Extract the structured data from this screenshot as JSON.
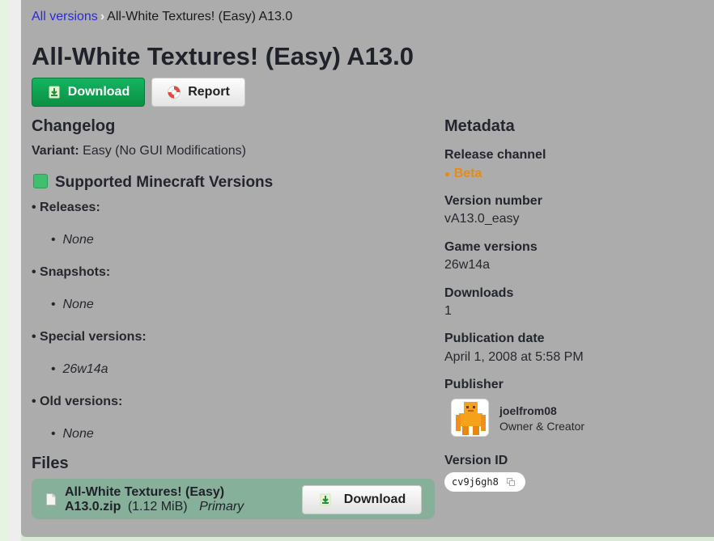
{
  "breadcrumb": {
    "parent": "All versions",
    "current": "All-White Textures! (Easy) A13.0"
  },
  "title": "All-White Textures! (Easy) A13.0",
  "actions": {
    "download": "Download",
    "report": "Report"
  },
  "changelog": {
    "heading": "Changelog",
    "variant_label": "Variant:",
    "variant_value": "Easy (No GUI Modifications)",
    "supported_heading": "Supported Minecraft Versions",
    "groups": [
      {
        "label": "• Releases:",
        "item": "None"
      },
      {
        "label": "• Snapshots:",
        "item": "None"
      },
      {
        "label": "• Special versions:",
        "item": "26w14a"
      },
      {
        "label": "• Old versions:",
        "item": "None"
      }
    ]
  },
  "files": {
    "heading": "Files",
    "file_name_line1": "All-White Textures! (Easy)",
    "file_name_line2": "A13.0.zip",
    "file_size": "(1.12 MiB)",
    "file_tag": "Primary",
    "download": "Download"
  },
  "metadata": {
    "heading": "Metadata",
    "release_channel_label": "Release channel",
    "release_channel_value": "Beta",
    "version_number_label": "Version number",
    "version_number_value": "vA13.0_easy",
    "game_versions_label": "Game versions",
    "game_versions_value": "26w14a",
    "downloads_label": "Downloads",
    "downloads_value": "1",
    "publication_date_label": "Publication date",
    "publication_date_value": "April 1, 2008 at 5:58 PM",
    "publisher_label": "Publisher",
    "publisher_name": "joelfrom08",
    "publisher_role": "Owner & Creator",
    "version_id_label": "Version ID",
    "version_id_value": "cv9j6gh8"
  },
  "colors": {
    "download_green": "#0e9e51",
    "beta_orange": "#e48b1a",
    "card_bg": "#acacac",
    "file_row_bg": "#87b09a"
  }
}
